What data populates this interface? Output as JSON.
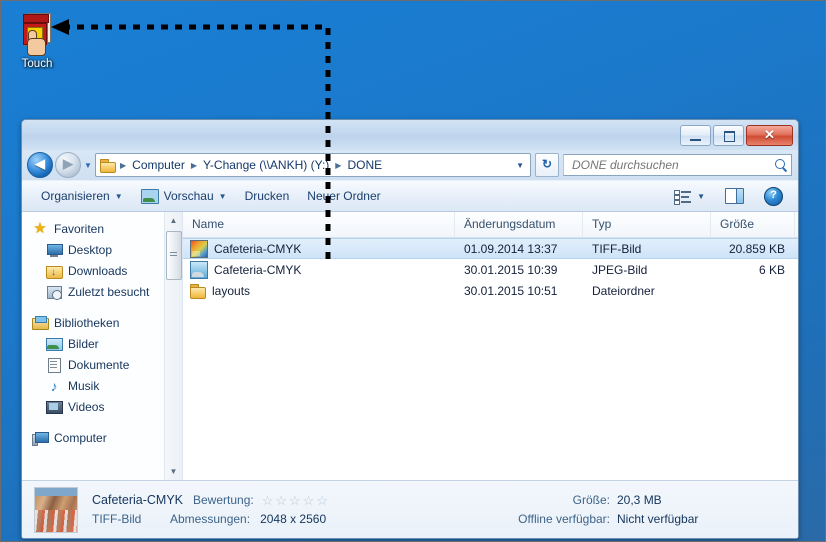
{
  "desktop": {
    "icon": {
      "label": "Touch",
      "icon_name": "touch-stack-icon"
    }
  },
  "annotation": {
    "type": "dashed-arrow",
    "description": "dashed callout arrow from selected file row to desktop icon",
    "color": "#000000"
  },
  "window": {
    "title": "DONE",
    "controls": {
      "minimize": "Minimieren",
      "maximize": "Maximieren",
      "close": "Schließen",
      "close_glyph": "✕"
    },
    "nav": {
      "back": "Zurück",
      "forward": "Vorwärts",
      "history_dropdown": "Zuletzt besuchte Seiten",
      "refresh": "Aktualisieren"
    },
    "breadcrumb": {
      "separator": "▶",
      "items": [
        "Computer",
        "Y-Change (\\\\ANKH) (Y:)",
        "DONE"
      ],
      "dropdown_caret": "▼"
    },
    "search": {
      "placeholder": "DONE durchsuchen",
      "value": "",
      "icon": "search-icon"
    },
    "toolbar": {
      "organize": "Organisieren",
      "preview": "Vorschau",
      "print": "Drucken",
      "new_folder": "Neuer Ordner",
      "caret": "▼",
      "views_icon": "views-list-icon",
      "panes_icon": "preview-pane-icon",
      "help_icon": "help-icon",
      "help_glyph": "?"
    }
  },
  "sidebar": {
    "groups": [
      {
        "label": "Favoriten",
        "icon": "star-icon",
        "items": [
          {
            "label": "Desktop",
            "icon": "monitor-icon"
          },
          {
            "label": "Downloads",
            "icon": "downloads-folder-icon"
          },
          {
            "label": "Zuletzt besucht",
            "icon": "recent-places-icon"
          }
        ]
      },
      {
        "label": "Bibliotheken",
        "icon": "libraries-icon",
        "items": [
          {
            "label": "Bilder",
            "icon": "pictures-icon"
          },
          {
            "label": "Dokumente",
            "icon": "documents-icon"
          },
          {
            "label": "Musik",
            "icon": "music-icon"
          },
          {
            "label": "Videos",
            "icon": "videos-icon"
          }
        ]
      },
      {
        "label": "Computer",
        "icon": "computer-icon",
        "items": []
      }
    ],
    "scrollbar": {
      "up_glyph": "▲",
      "down_glyph": "▼"
    }
  },
  "filelist": {
    "columns": [
      "Name",
      "Änderungsdatum",
      "Typ",
      "Größe"
    ],
    "rows": [
      {
        "name": "Cafeteria-CMYK",
        "date": "01.09.2014 13:37",
        "type": "TIFF-Bild",
        "size": "20.859 KB",
        "icon": "tiff-image-icon",
        "selected": true
      },
      {
        "name": "Cafeteria-CMYK",
        "date": "30.01.2015 10:39",
        "type": "JPEG-Bild",
        "size": "6 KB",
        "icon": "jpeg-image-icon",
        "selected": false
      },
      {
        "name": "layouts",
        "date": "30.01.2015 10:51",
        "type": "Dateiordner",
        "size": "",
        "icon": "folder-icon",
        "selected": false
      }
    ]
  },
  "details": {
    "thumbnail": "cafeteria-photo-thumbnail",
    "title": "Cafeteria-CMYK",
    "subtitle": "TIFF-Bild",
    "rating_label": "Bewertung:",
    "rating_stars": 5,
    "rating_filled": 0,
    "star_glyph": "☆",
    "dimensions_label": "Abmessungen:",
    "dimensions_value": "2048 x 2560",
    "size_label": "Größe:",
    "size_value": "20,3 MB",
    "offline_label": "Offline verfügbar:",
    "offline_value": "Nicht verfügbar"
  }
}
